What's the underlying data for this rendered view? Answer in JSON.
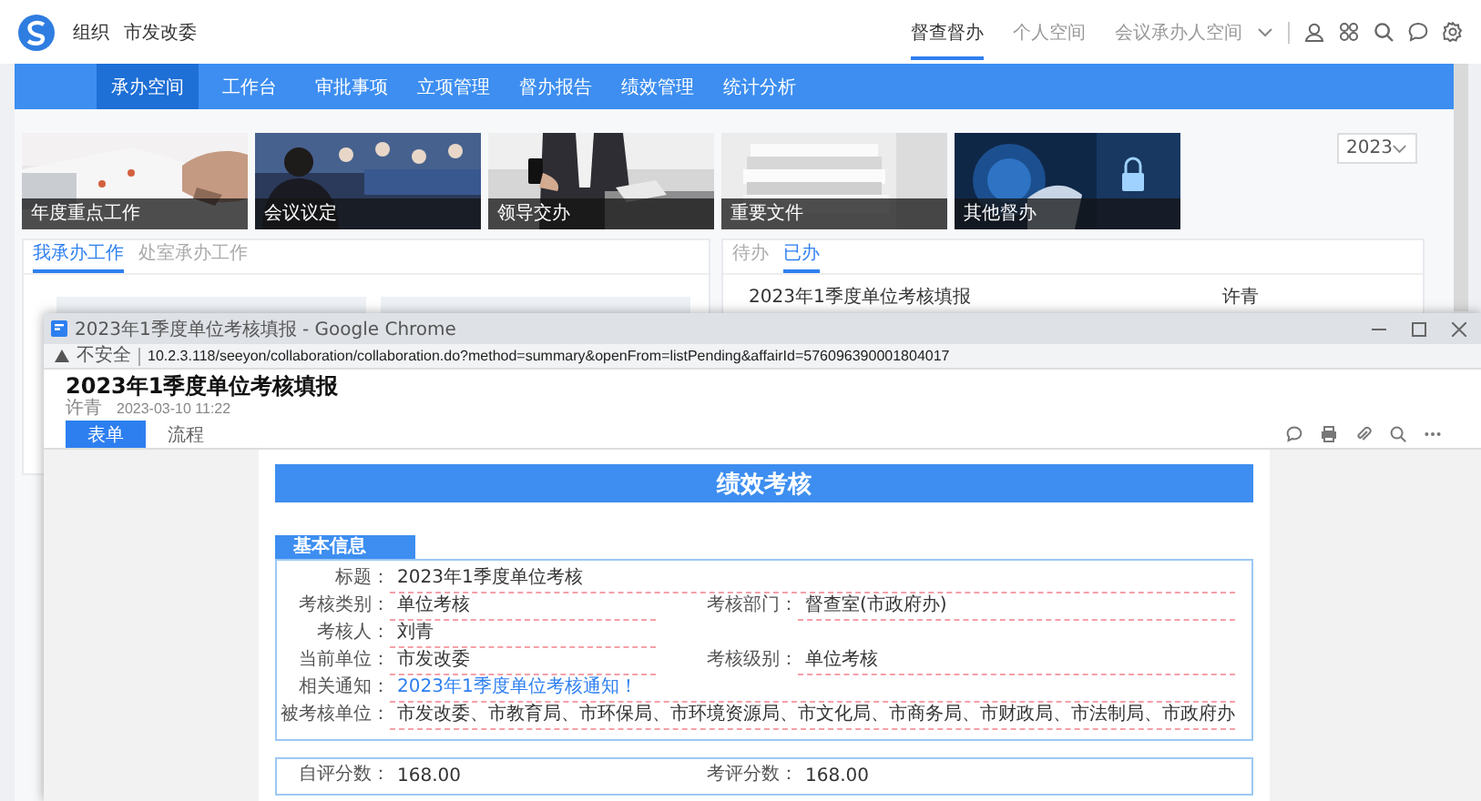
{
  "header": {
    "org_label": "组织",
    "org_name": "市发改委",
    "spaces": [
      {
        "label": "督查督办",
        "selected": true
      },
      {
        "label": "个人空间",
        "selected": false
      },
      {
        "label": "会议承办人空间",
        "selected": false
      }
    ]
  },
  "nav": [
    {
      "label": "承办空间",
      "selected": true
    },
    {
      "label": "工作台",
      "selected": false
    },
    {
      "label": "审批事项",
      "selected": false
    },
    {
      "label": "立项管理",
      "selected": false
    },
    {
      "label": "督办报告",
      "selected": false
    },
    {
      "label": "绩效管理",
      "selected": false
    },
    {
      "label": "统计分析",
      "selected": false
    }
  ],
  "banners": [
    {
      "caption": "年度重点工作",
      "kind": "picture"
    },
    {
      "caption": "会议议定",
      "kind": "picture"
    },
    {
      "caption": "领导交办",
      "kind": "picture"
    },
    {
      "caption": "重要文件",
      "kind": "picture"
    },
    {
      "caption": "其他督办",
      "kind": "picture"
    }
  ],
  "year_select": {
    "value": "2023"
  },
  "left_panel": {
    "tabs": [
      {
        "label": "我承办工作",
        "selected": true
      },
      {
        "label": "处室承办工作",
        "selected": false
      }
    ]
  },
  "right_panel": {
    "tabs": [
      {
        "label": "待办",
        "selected": false
      },
      {
        "label": "已办",
        "selected": true
      }
    ],
    "rows": [
      {
        "title": "2023年1季度单位考核填报",
        "person": "许青"
      }
    ]
  },
  "popup": {
    "window_title": "2023年1季度单位考核填报 - Google Chrome",
    "security": "不安全",
    "url": "10.2.3.118/seeyon/collaboration/collaboration.do?method=summary&openFrom=listPending&affairId=576096390001804017",
    "doc_title": "2023年1季度单位考核填报",
    "author": "许青",
    "date": "2023-03-10 11:22",
    "tabs": [
      {
        "label": "表单",
        "selected": true
      },
      {
        "label": "流程",
        "selected": false
      }
    ],
    "form": {
      "title": "绩效考核",
      "section": "基本信息",
      "rows": [
        [
          {
            "label": "标题：",
            "value": "2023年1季度单位考核",
            "kind": "text",
            "wide": true
          }
        ],
        [
          {
            "label": "考核类别：",
            "value": "单位考核",
            "kind": "text",
            "wide": false
          },
          {
            "label": "考核部门：",
            "value": "督查室(市政府办)",
            "kind": "text",
            "wide": false
          }
        ],
        [
          {
            "label": "考核人：",
            "value": "刘青",
            "kind": "text",
            "wide": false
          }
        ],
        [
          {
            "label": "当前单位：",
            "value": "市发改委",
            "kind": "text",
            "wide": false
          },
          {
            "label": "考核级别：",
            "value": "单位考核",
            "kind": "text",
            "wide": false
          }
        ],
        [
          {
            "label": "相关通知：",
            "value": "2023年1季度单位考核通知！",
            "kind": "link",
            "wide": true
          }
        ],
        [
          {
            "label": "被考核单位：",
            "value": "市发改委、市教育局、市环保局、市环境资源局、市文化局、市商务局、市财政局、市法制局、市政府办",
            "kind": "text",
            "wide": true
          }
        ]
      ],
      "scores": [
        {
          "label": "自评分数：",
          "value": "168.00"
        },
        {
          "label": "考评分数：",
          "value": "168.00"
        }
      ]
    }
  }
}
